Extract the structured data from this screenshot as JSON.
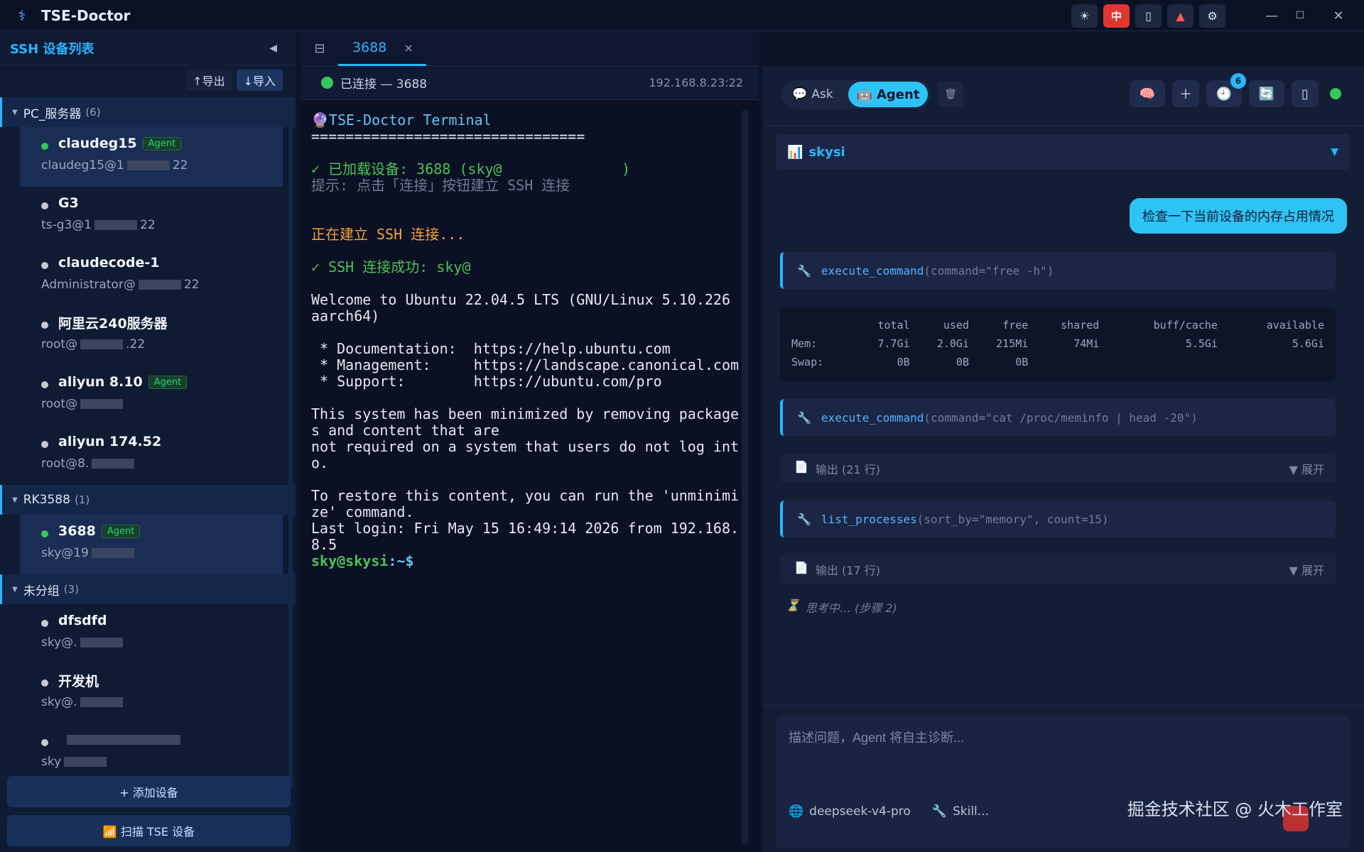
{
  "window": {
    "title": "TSE-Doctor",
    "tools": {
      "theme_icon": "sun-icon",
      "lang": "中",
      "phone_icon": "phone-icon",
      "alert_icon": "siren-icon",
      "settings_icon": "gear-icon"
    },
    "minimize": "—",
    "maximize": "☐",
    "close": "✕"
  },
  "sidebar": {
    "title": "SSH 设备列表",
    "collapse": "◀",
    "export_label": "↑导出",
    "import_label": "↓导入",
    "groups": [
      {
        "name": "PC_服务器",
        "count": "(6)",
        "devices": [
          {
            "name": "claudeg15",
            "badge": "Agent",
            "addr_prefix": "claudeg15@1",
            "addr_suffix": "22",
            "online": true,
            "active": true
          },
          {
            "name": "G3",
            "badge": "",
            "addr_prefix": "ts-g3@1",
            "addr_suffix": "22",
            "online": false
          },
          {
            "name": "claudecode-1",
            "badge": "",
            "addr_prefix": "Administrator@",
            "addr_suffix": "22",
            "online": false
          },
          {
            "name": "阿里云240服务器",
            "badge": "",
            "addr_prefix": "root@",
            "addr_suffix": ".22",
            "online": false
          },
          {
            "name": "aliyun 8.10",
            "badge": "Agent",
            "addr_prefix": "root@",
            "addr_suffix": "",
            "online": false
          },
          {
            "name": "aliyun 174.52",
            "badge": "",
            "addr_prefix": "root@8.",
            "addr_suffix": "",
            "online": false
          }
        ]
      },
      {
        "name": "RK3588",
        "count": "(1)",
        "devices": [
          {
            "name": "3688",
            "badge": "Agent",
            "addr_prefix": "sky@19",
            "addr_suffix": "",
            "online": true,
            "active": true
          }
        ]
      },
      {
        "name": "未分组",
        "count": "(3)",
        "devices": [
          {
            "name": "dfsdfd",
            "badge": "",
            "addr_prefix": "sky@.",
            "addr_suffix": "",
            "online": false
          },
          {
            "name": "开发机",
            "badge": "",
            "addr_prefix": "sky@.",
            "addr_suffix": "",
            "online": false
          },
          {
            "name": "",
            "badge": "",
            "addr_prefix": "sky",
            "addr_suffix": "",
            "online": false
          }
        ]
      }
    ],
    "add_device": "+ 添加设备",
    "scan_device": "📶 扫描 TSE 设备"
  },
  "terminal": {
    "tab_label": "3688",
    "tab_close": "×",
    "status": "已连接 — 3688",
    "host": "192.168.8.23:22",
    "lines": [
      {
        "cls": "t-cyan",
        "text": "🔮TSE-Doctor Terminal"
      },
      {
        "cls": "",
        "text": "================================"
      },
      {
        "cls": "",
        "text": ""
      },
      {
        "cls": "t-green",
        "text": "✓ 已加载设备: 3688 (sky@              )"
      },
      {
        "cls": "t-gray",
        "text": "提示: 点击「连接」按钮建立 SSH 连接"
      },
      {
        "cls": "",
        "text": ""
      },
      {
        "cls": "",
        "text": ""
      },
      {
        "cls": "t-orange",
        "text": "正在建立 SSH 连接..."
      },
      {
        "cls": "",
        "text": ""
      },
      {
        "cls": "t-green",
        "text": "✓ SSH 连接成功: sky@"
      },
      {
        "cls": "",
        "text": ""
      },
      {
        "cls": "",
        "text": "Welcome to Ubuntu 22.04.5 LTS (GNU/Linux 5.10.226"
      },
      {
        "cls": "",
        "text": "aarch64)"
      },
      {
        "cls": "",
        "text": ""
      },
      {
        "cls": "",
        "text": " * Documentation:  https://help.ubuntu.com"
      },
      {
        "cls": "",
        "text": " * Management:     https://landscape.canonical.com"
      },
      {
        "cls": "",
        "text": " * Support:        https://ubuntu.com/pro"
      },
      {
        "cls": "",
        "text": ""
      },
      {
        "cls": "",
        "text": "This system has been minimized by removing package"
      },
      {
        "cls": "",
        "text": "s and content that are"
      },
      {
        "cls": "",
        "text": "not required on a system that users do not log int"
      },
      {
        "cls": "",
        "text": "o."
      },
      {
        "cls": "",
        "text": ""
      },
      {
        "cls": "",
        "text": "To restore this content, you can run the 'unminimi"
      },
      {
        "cls": "",
        "text": "ze' command."
      },
      {
        "cls": "",
        "text": "Last login: Fri May 15 16:49:14 2026 from 192.168."
      },
      {
        "cls": "",
        "text": "8.5"
      }
    ],
    "prompt_user": "sky@skysi",
    "prompt_path": ":~$"
  },
  "agent": {
    "mode_ask": "Ask",
    "mode_agent": "Agent",
    "tool_icons": [
      "brain-icon",
      "plus-icon",
      "history-icon",
      "refresh-icon",
      "phone-icon"
    ],
    "history_count": "6",
    "device_select": "skysi",
    "user_message": "检查一下当前设备的内存占用情况",
    "calls": [
      {
        "fn": "execute_command",
        "args": "(command=\"free -h\")"
      },
      {
        "fn": "execute_command",
        "args": "(command=\"cat /proc/meminfo | head -20\")"
      },
      {
        "fn": "list_processes",
        "args": "(sort_by=\"memory\", count=15)"
      }
    ],
    "free_output": {
      "headers": [
        "",
        "total",
        "used",
        "free",
        "shared",
        "buff/cache",
        "available"
      ],
      "rows": [
        [
          "Mem:",
          "7.7Gi",
          "2.0Gi",
          "215Mi",
          "74Mi",
          "5.5Gi",
          "5.6Gi"
        ],
        [
          "Swap:",
          "0B",
          "0B",
          "0B",
          "",
          "",
          ""
        ]
      ]
    },
    "outputs": [
      {
        "label": "输出 (21 行)",
        "expand": "▼ 展开"
      },
      {
        "label": "输出 (17 行)",
        "expand": "▼ 展开"
      }
    ],
    "thinking": "思考中… (步骤 2)",
    "input_placeholder": "描述问题，Agent 将自主诊断...",
    "model": "deepseek-v4-pro",
    "skill": "Skill...",
    "watermark": "掘金技术社区 @ 火木工作室"
  }
}
